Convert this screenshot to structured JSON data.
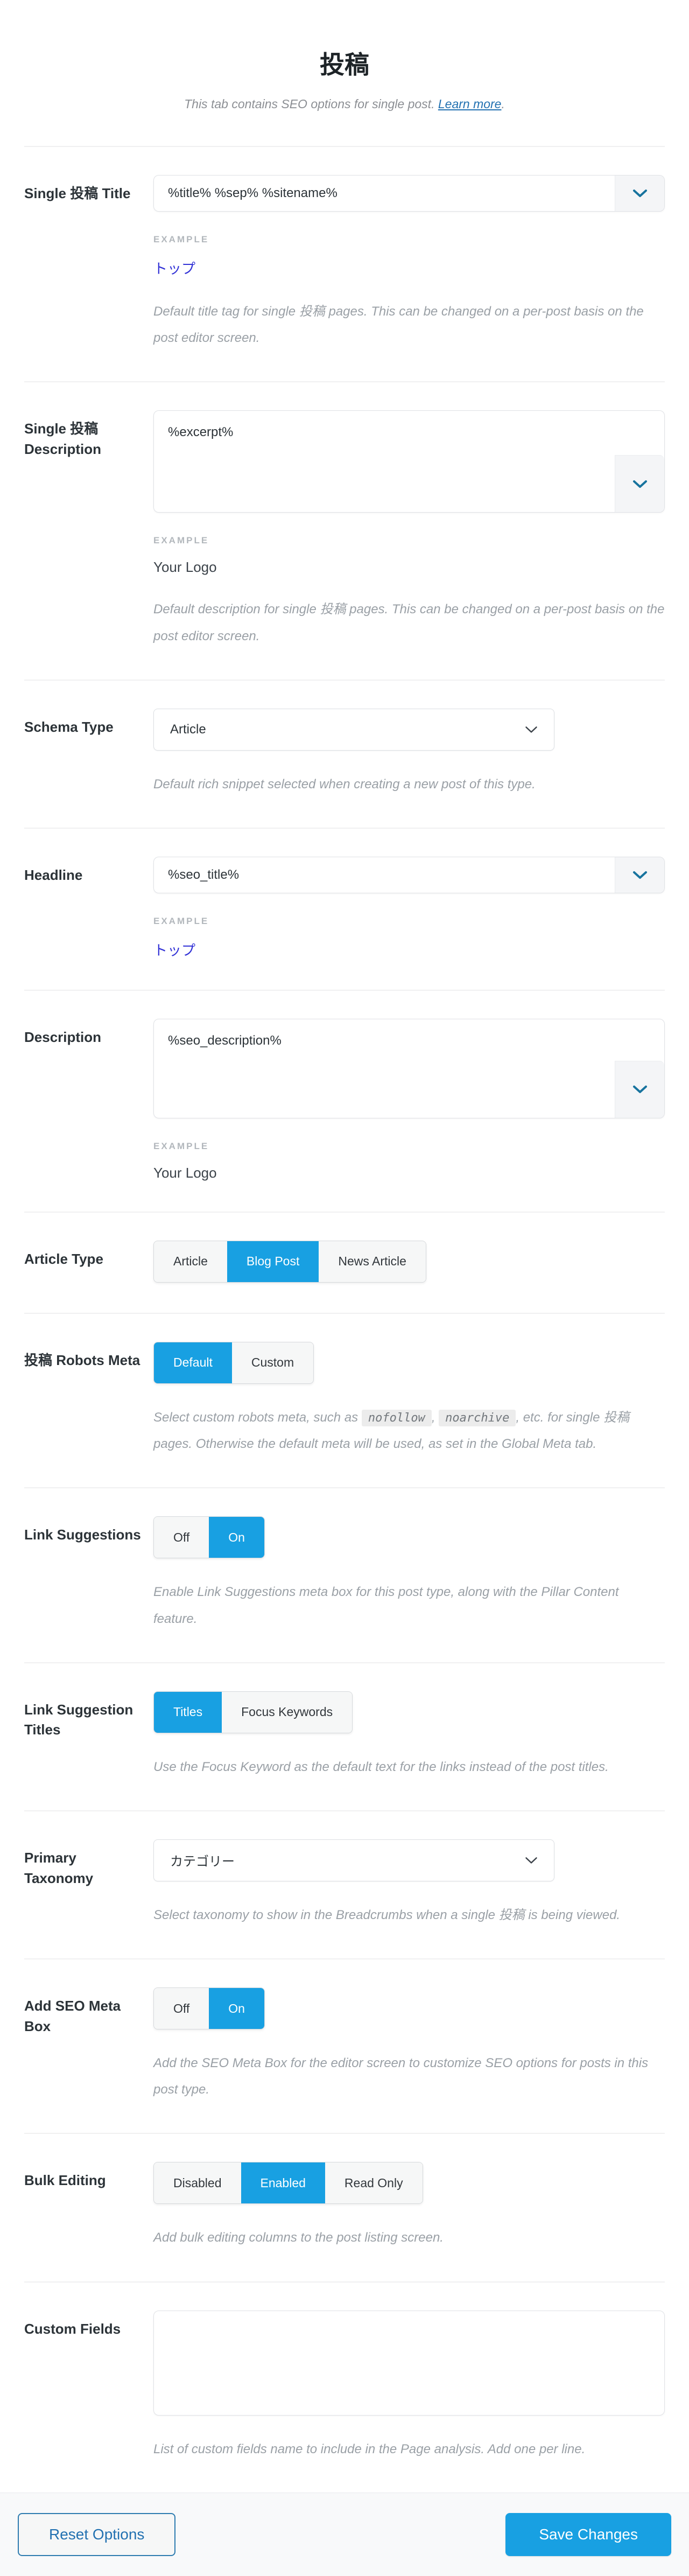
{
  "header": {
    "title": "投稿",
    "subtitle_text": "This tab contains SEO options for single post. ",
    "learn_more_label": "Learn more",
    "subtitle_period": "."
  },
  "example_label": "EXAMPLE",
  "colors": {
    "accent_blue": "#18a0e2",
    "link_blue": "#2271b1",
    "example_link_blue": "#3232d6",
    "variable_chevron_blue": "#17739e",
    "select_chevron_gray": "#3c434a",
    "segment_inactive_bg": "#f6f7f7",
    "footer_bg": "#f8f9fa"
  },
  "icons": {
    "variable_toggle": "chevron-down-icon",
    "select_arrow": "chevron-down-icon"
  },
  "sections": [
    {
      "id": "single-post-title",
      "label": "Single 投稿 Title",
      "control": {
        "type": "variable-input",
        "value": "%title% %sep% %sitename%"
      },
      "example": {
        "value": "トップ",
        "link": true
      },
      "description": [
        {
          "text": "Default title tag for single 投稿 pages. This can be changed on a per-post basis on the post editor screen."
        }
      ]
    },
    {
      "id": "single-post-description",
      "label": "Single 投稿 Description",
      "control": {
        "type": "variable-textarea",
        "value": "%excerpt%",
        "height": 190
      },
      "example": {
        "value": "Your Logo",
        "link": false
      },
      "description": [
        {
          "text": "Default description for single 投稿 pages. This can be changed on a per-post basis on the post editor screen."
        }
      ]
    },
    {
      "id": "schema-type",
      "label": "Schema Type",
      "control": {
        "type": "select",
        "value": "Article"
      },
      "description": [
        {
          "text": "Default rich snippet selected when creating a new post of this type."
        }
      ]
    },
    {
      "id": "headline",
      "label": "Headline",
      "control": {
        "type": "variable-input",
        "value": "%seo_title%"
      },
      "example": {
        "value": "トップ",
        "link": true
      }
    },
    {
      "id": "description",
      "label": "Description",
      "control": {
        "type": "variable-textarea",
        "value": "%seo_description%",
        "height": 185
      },
      "example": {
        "value": "Your Logo",
        "link": false
      }
    },
    {
      "id": "article-type",
      "label": "Article Type",
      "control": {
        "type": "segmented",
        "options": [
          "Article",
          "Blog Post",
          "News Article"
        ],
        "active": 1
      }
    },
    {
      "id": "post-robots-meta",
      "label": "投稿 Robots Meta",
      "control": {
        "type": "segmented",
        "options": [
          "Default",
          "Custom"
        ],
        "active": 0
      },
      "description": [
        {
          "text": "Select custom robots meta, such as "
        },
        {
          "code": "nofollow"
        },
        {
          "text": ", "
        },
        {
          "code": "noarchive"
        },
        {
          "text": ", etc. for single 投稿 pages. Otherwise the default meta will be used, as set in the Global Meta tab."
        }
      ]
    },
    {
      "id": "link-suggestions",
      "label": "Link Suggestions",
      "control": {
        "type": "segmented",
        "options": [
          "Off",
          "On"
        ],
        "active": 1
      },
      "description": [
        {
          "text": "Enable Link Suggestions meta box for this post type, along with the Pillar Content feature."
        }
      ]
    },
    {
      "id": "link-suggestion-titles",
      "label": "Link Suggestion Titles",
      "control": {
        "type": "segmented",
        "options": [
          "Titles",
          "Focus Keywords"
        ],
        "active": 0
      },
      "description": [
        {
          "text": "Use the Focus Keyword as the default text for the links instead of the post titles."
        }
      ]
    },
    {
      "id": "primary-taxonomy",
      "label": "Primary Taxonomy",
      "control": {
        "type": "select",
        "value": "カテゴリー"
      },
      "description": [
        {
          "text": "Select taxonomy to show in the Breadcrumbs when a single 投稿 is being viewed."
        }
      ]
    },
    {
      "id": "add-seo-meta-box",
      "label": "Add SEO Meta Box",
      "control": {
        "type": "segmented",
        "options": [
          "Off",
          "On"
        ],
        "active": 1
      },
      "description": [
        {
          "text": "Add the SEO Meta Box for the editor screen to customize SEO options for posts in this post type."
        }
      ]
    },
    {
      "id": "bulk-editing",
      "label": "Bulk Editing",
      "control": {
        "type": "segmented",
        "options": [
          "Disabled",
          "Enabled",
          "Read Only"
        ],
        "active": 1
      },
      "description": [
        {
          "text": "Add bulk editing columns to the post listing screen."
        }
      ]
    },
    {
      "id": "custom-fields",
      "label": "Custom Fields",
      "control": {
        "type": "textarea",
        "value": "",
        "height": 195
      },
      "description": [
        {
          "text": "List of custom fields name to include in the Page analysis. Add one per line."
        }
      ]
    }
  ],
  "footer": {
    "reset_label": "Reset Options",
    "save_label": "Save Changes"
  }
}
